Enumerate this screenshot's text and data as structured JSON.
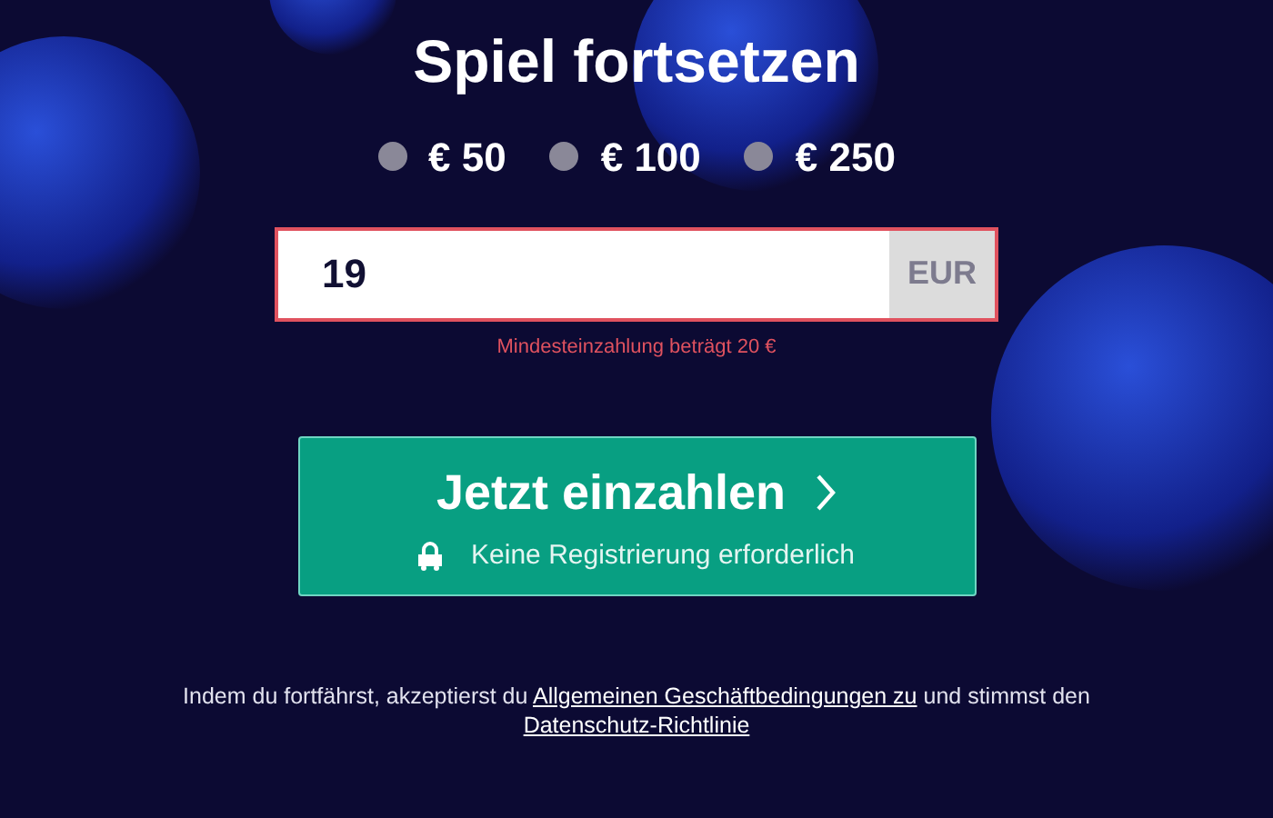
{
  "title": "Spiel fortsetzen",
  "amount_options": [
    {
      "label": "€ 50",
      "selected": false
    },
    {
      "label": "€ 100",
      "selected": false
    },
    {
      "label": "€ 250",
      "selected": false
    }
  ],
  "amount_field": {
    "value": "19",
    "currency": "EUR",
    "invalid": true,
    "error": "Mindesteinzahlung beträgt 20 €"
  },
  "deposit_button": {
    "label": "Jetzt einzahlen",
    "subtitle": "Keine Registrierung erforderlich"
  },
  "consent": {
    "text_before": "Indem du fortfährst, akzeptierst du ",
    "terms_link": "Allgemeinen Geschäftbedingungen zu",
    "text_middle": " und stimmst den ",
    "privacy_link": "Datenschutz-Richtlinie"
  }
}
